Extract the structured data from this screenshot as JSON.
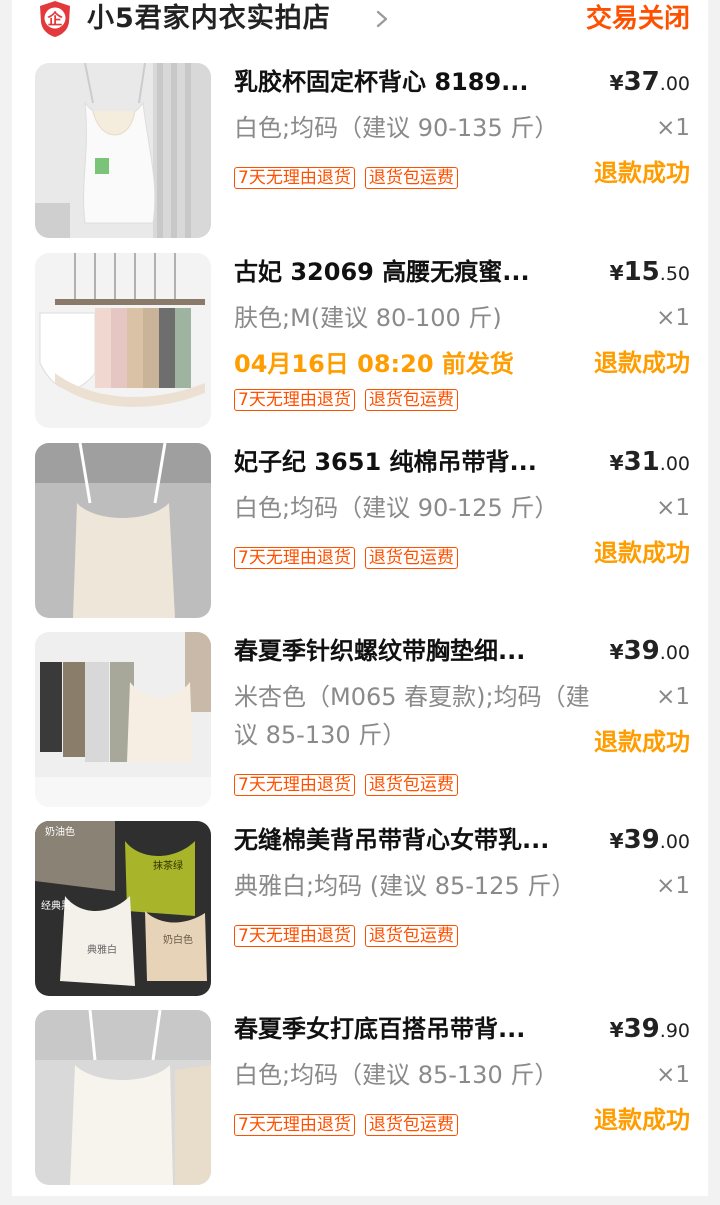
{
  "shop": {
    "badge_icon": "enterprise-shield-icon",
    "badge_text": "企",
    "name": "小5君家内衣实拍店",
    "order_status": "交易关闭"
  },
  "colors": {
    "accent": "#ff5000",
    "status_orange": "#ff9d00",
    "badge_red": "#e4393c"
  },
  "items": [
    {
      "title": "乳胶杯固定杯背心 8189...",
      "spec": "白色;均码（建议 90-135 斤）",
      "price_currency": "¥",
      "price_int": "37",
      "price_dec": ".00",
      "qty": "×1",
      "tags": [
        "7天无理由退货",
        "退货包运费"
      ],
      "status": "退款成功"
    },
    {
      "title": "古妃 32069 高腰无痕蜜...",
      "spec": "肤色;M(建议 80-100 斤)",
      "ship_note": "04月16日 08:20 前发货",
      "price_currency": "¥",
      "price_int": "15",
      "price_dec": ".50",
      "qty": "×1",
      "tags": [
        "7天无理由退货",
        "退货包运费"
      ],
      "status": "退款成功"
    },
    {
      "title": "妃子纪 3651 纯棉吊带背...",
      "spec": "白色;均码（建议 90-125 斤）",
      "price_currency": "¥",
      "price_int": "31",
      "price_dec": ".00",
      "qty": "×1",
      "tags": [
        "7天无理由退货",
        "退货包运费"
      ],
      "status": "退款成功"
    },
    {
      "title": "春夏季针织螺纹带胸垫细...",
      "spec": "米杏色（M065 春夏款);均码（建议 85-130 斤）",
      "price_currency": "¥",
      "price_int": "39",
      "price_dec": ".00",
      "qty": "×1",
      "tags": [
        "7天无理由退货",
        "退货包运费"
      ],
      "status": "退款成功"
    },
    {
      "title": "无缝棉美背吊带背心女带乳...",
      "spec": "典雅白;均码 (建议 85-125 斤）",
      "price_currency": "¥",
      "price_int": "39",
      "price_dec": ".00",
      "qty": "×1",
      "tags": [
        "7天无理由退货",
        "退货包运费"
      ],
      "status": ""
    },
    {
      "title": "春夏季女打底百搭吊带背...",
      "spec": "白色;均码（建议 85-130 斤）",
      "price_currency": "¥",
      "price_int": "39",
      "price_dec": ".90",
      "qty": "×1",
      "tags": [
        "7天无理由退货",
        "退货包运费"
      ],
      "status": "退款成功"
    }
  ],
  "thumb_labels": {
    "item5": [
      "奶油色",
      "抹茶绿",
      "经典黑",
      "典雅白",
      "奶白色"
    ]
  }
}
